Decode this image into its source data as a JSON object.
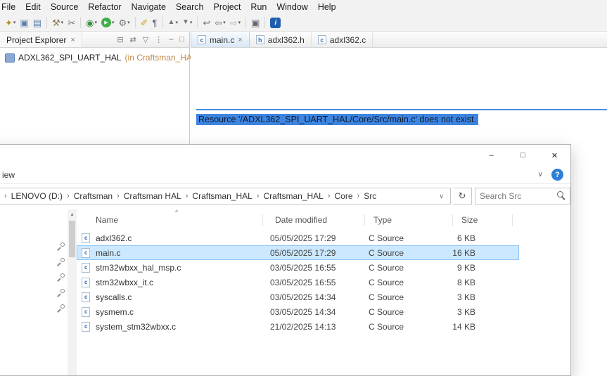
{
  "icons": {
    "breadcrumb_separator": "›",
    "refresh": "↻",
    "help": "?",
    "ribbon_collapse": "∨",
    "sort_ascending": "^",
    "close_tab": "×",
    "window_minimize": "–",
    "window_maximize": "□",
    "window_close": "✕"
  },
  "ide": {
    "menu": [
      "File",
      "Edit",
      "Source",
      "Refactor",
      "Navigate",
      "Search",
      "Project",
      "Run",
      "Window",
      "Help"
    ],
    "project_explorer": {
      "title": "Project Explorer",
      "project_name": "ADXL362_SPI_UART_HAL",
      "project_decorator": "(in Craftsman_HAL)"
    },
    "editor_tabs": [
      {
        "label": "main.c",
        "icon": "c"
      },
      {
        "label": "adxl362.h",
        "icon": "h"
      },
      {
        "label": "adxl362.c",
        "icon": "c"
      }
    ],
    "editor_message": "Resource '/ADXL362_SPI_UART_HAL/Core/Src/main.c' does not exist."
  },
  "explorer": {
    "view_tab_label": "iew",
    "breadcrumb": [
      "LENOVO (D:)",
      "Craftsman",
      "Craftsman HAL",
      "Craftsman_HAL",
      "Craftsman_HAL",
      "Core",
      "Src"
    ],
    "search_placeholder": "Search Src",
    "columns": {
      "name": "Name",
      "modified": "Date modified",
      "type": "Type",
      "size": "Size"
    },
    "files": [
      {
        "name": "adxl362.c",
        "modified": "05/05/2025 17:29",
        "type": "C Source",
        "size": "6 KB"
      },
      {
        "name": "main.c",
        "modified": "05/05/2025 17:29",
        "type": "C Source",
        "size": "16 KB"
      },
      {
        "name": "stm32wbxx_hal_msp.c",
        "modified": "03/05/2025 16:55",
        "type": "C Source",
        "size": "9 KB"
      },
      {
        "name": "stm32wbxx_it.c",
        "modified": "03/05/2025 16:55",
        "type": "C Source",
        "size": "8 KB"
      },
      {
        "name": "syscalls.c",
        "modified": "03/05/2025 14:34",
        "type": "C Source",
        "size": "3 KB"
      },
      {
        "name": "sysmem.c",
        "modified": "03/05/2025 14:34",
        "type": "C Source",
        "size": "3 KB"
      },
      {
        "name": "system_stm32wbxx.c",
        "modified": "21/02/2025 14:13",
        "type": "C Source",
        "size": "14 KB"
      }
    ]
  }
}
